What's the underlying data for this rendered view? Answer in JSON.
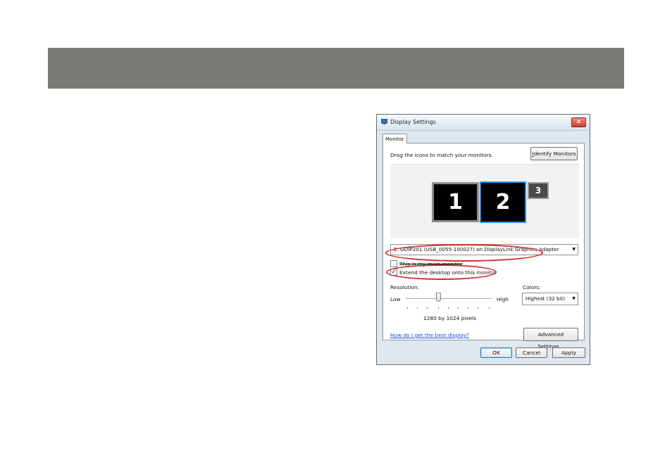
{
  "page": {
    "band_color": "#7a7a76",
    "annotation_color": "#d9242c"
  },
  "dialog": {
    "title": "Display Settings",
    "close_glyph": "✕",
    "tab_label": "Monitor",
    "instructions": "Drag the icons to match your monitors.",
    "identify_button": "Identify Monitors",
    "identify_access_key": "I",
    "identify_rest": "dentify Monitors",
    "monitors": [
      "1",
      "2",
      "3"
    ],
    "adapter_select": "2. GDIP201 (USB_0055-100027) on DisplayLink Graphics Adapter",
    "main_monitor_checkbox": {
      "label": "This is my main monitor",
      "checked": false
    },
    "extend_checkbox": {
      "label": "Extend the desktop onto this monitor",
      "checked": true
    },
    "resolution": {
      "label": "Resolution:",
      "low": "Low",
      "high": "High",
      "value_text": "1280 by 1024 pixels"
    },
    "colors": {
      "label": "Colors:",
      "selected": "Highest (32 bit)"
    },
    "help_link": "How do I get the best display?",
    "advanced_button": "Advanced Settings...",
    "ok_button": "OK",
    "cancel_button": "Cancel",
    "apply_button": "Apply"
  }
}
